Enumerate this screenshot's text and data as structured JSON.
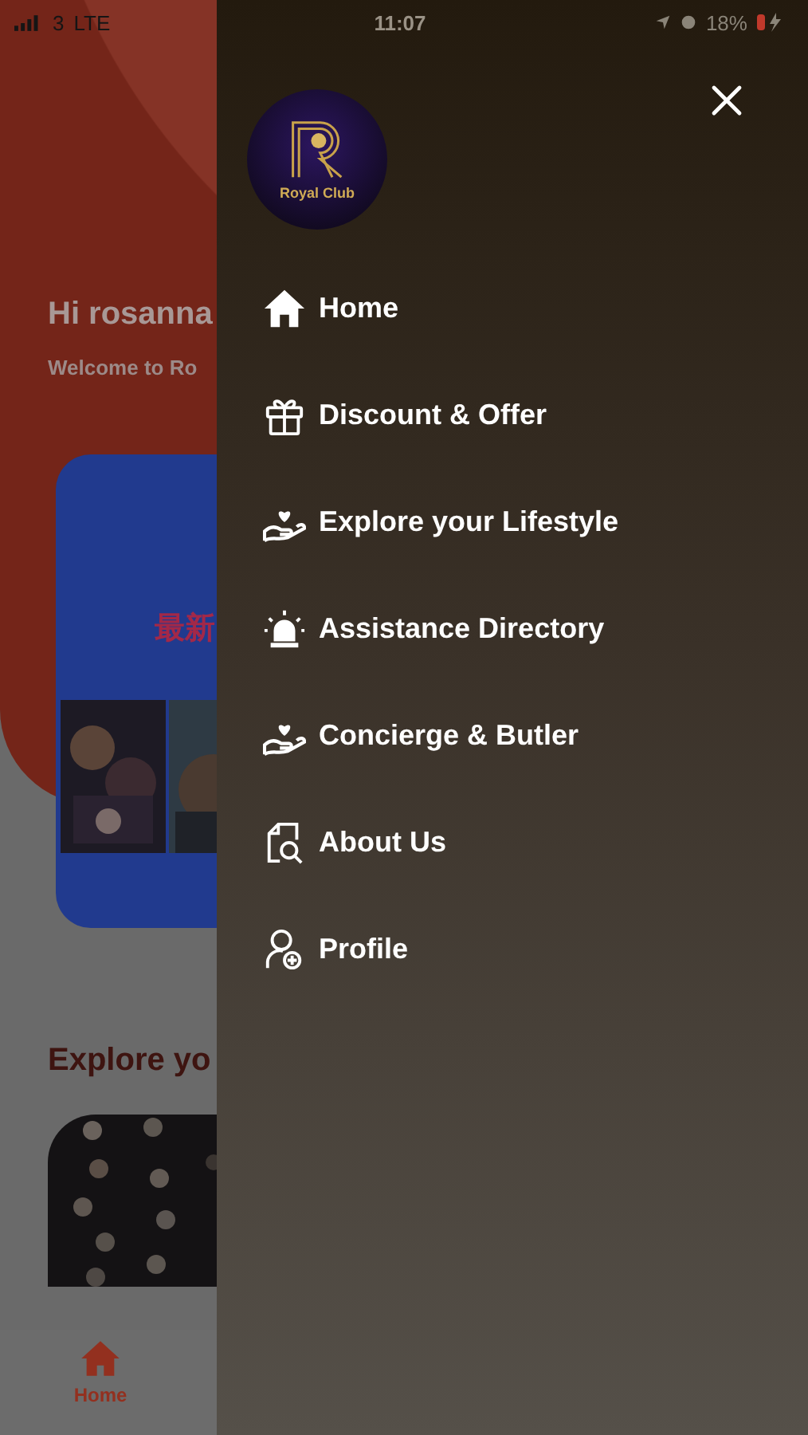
{
  "status_bar": {
    "carrier": "3",
    "network": "LTE",
    "time": "11:07",
    "battery": "18%"
  },
  "background": {
    "greeting": "Hi rosanna",
    "welcome": "Welcome to Ro",
    "banner_title": "最新",
    "section_title": "Explore yo",
    "bottom_nav": [
      {
        "label": "Home",
        "selected": true
      }
    ]
  },
  "drawer": {
    "logo_text": "Royal Club",
    "items": [
      {
        "label": "Home",
        "kind": "home"
      },
      {
        "label": "Discount & Offer",
        "kind": "gift"
      },
      {
        "label": "Explore your Lifestyle",
        "kind": "care"
      },
      {
        "label": "Assistance Directory",
        "kind": "alarm"
      },
      {
        "label": "Concierge & Butler",
        "kind": "care"
      },
      {
        "label": "About Us",
        "kind": "document"
      },
      {
        "label": "Profile",
        "kind": "profile"
      }
    ]
  }
}
